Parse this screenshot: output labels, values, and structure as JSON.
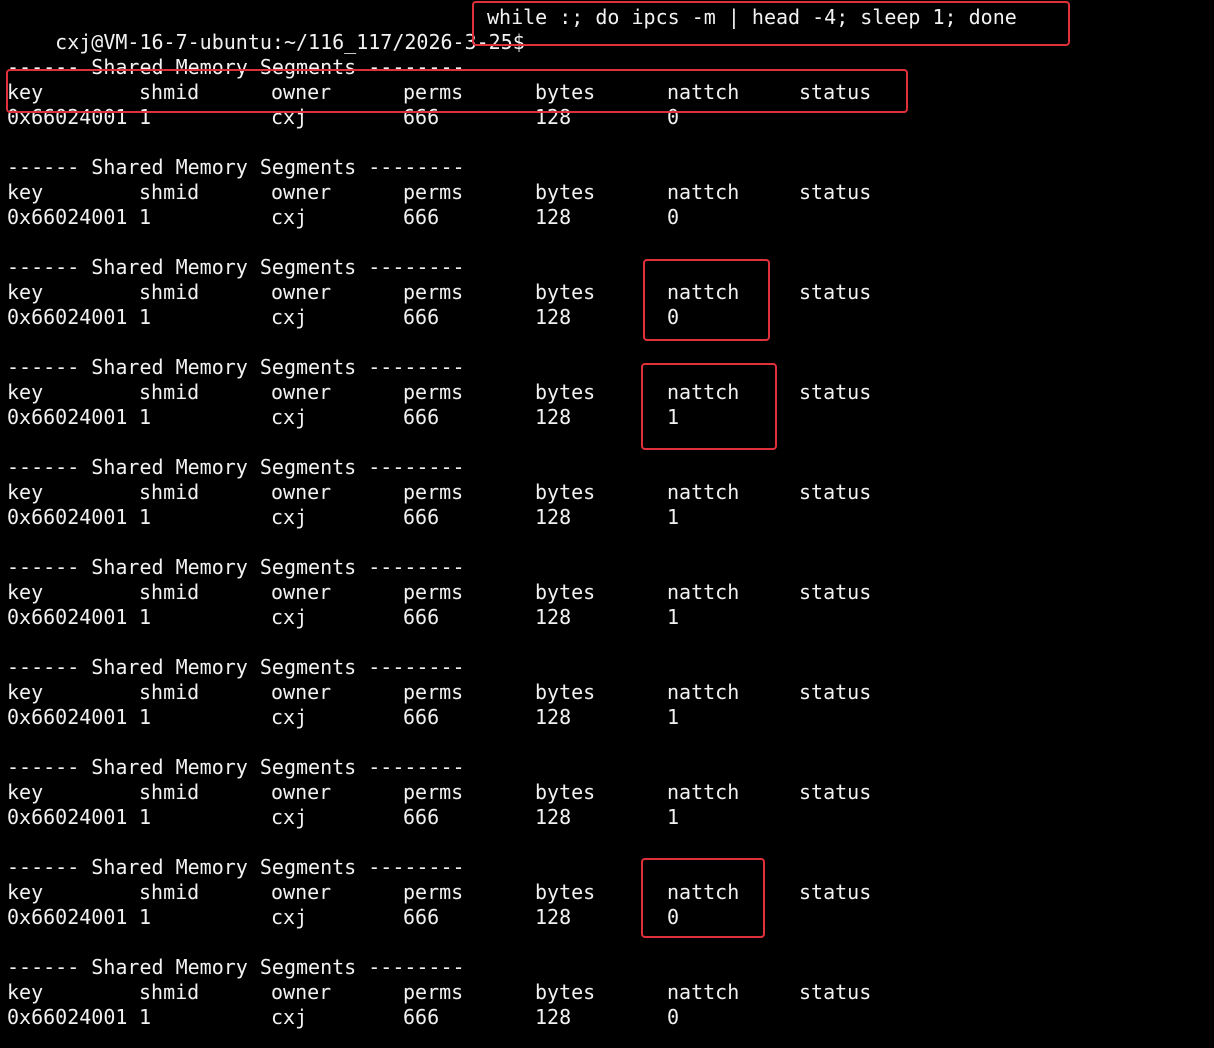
{
  "prompt": {
    "text": "cxj@VM-16-7-ubuntu:~/116_117/2026-3-25$",
    "command": "while :; do ipcs -m | head -4; sleep 1; done"
  },
  "header_line": "------ Shared Memory Segments --------",
  "columns": [
    "key",
    "shmid",
    "owner",
    "perms",
    "bytes",
    "nattch",
    "status"
  ],
  "blocks": [
    {
      "key": "0x66024001",
      "shmid": "1",
      "owner": "cxj",
      "perms": "666",
      "bytes": "128",
      "nattch": "0",
      "status": ""
    },
    {
      "key": "0x66024001",
      "shmid": "1",
      "owner": "cxj",
      "perms": "666",
      "bytes": "128",
      "nattch": "0",
      "status": ""
    },
    {
      "key": "0x66024001",
      "shmid": "1",
      "owner": "cxj",
      "perms": "666",
      "bytes": "128",
      "nattch": "0",
      "status": ""
    },
    {
      "key": "0x66024001",
      "shmid": "1",
      "owner": "cxj",
      "perms": "666",
      "bytes": "128",
      "nattch": "1",
      "status": ""
    },
    {
      "key": "0x66024001",
      "shmid": "1",
      "owner": "cxj",
      "perms": "666",
      "bytes": "128",
      "nattch": "1",
      "status": ""
    },
    {
      "key": "0x66024001",
      "shmid": "1",
      "owner": "cxj",
      "perms": "666",
      "bytes": "128",
      "nattch": "1",
      "status": ""
    },
    {
      "key": "0x66024001",
      "shmid": "1",
      "owner": "cxj",
      "perms": "666",
      "bytes": "128",
      "nattch": "1",
      "status": ""
    },
    {
      "key": "0x66024001",
      "shmid": "1",
      "owner": "cxj",
      "perms": "666",
      "bytes": "128",
      "nattch": "1",
      "status": ""
    },
    {
      "key": "0x66024001",
      "shmid": "1",
      "owner": "cxj",
      "perms": "666",
      "bytes": "128",
      "nattch": "0",
      "status": ""
    },
    {
      "key": "0x66024001",
      "shmid": "1",
      "owner": "cxj",
      "perms": "666",
      "bytes": "128",
      "nattch": "0",
      "status": ""
    }
  ],
  "highlight_color": "#e0303a"
}
